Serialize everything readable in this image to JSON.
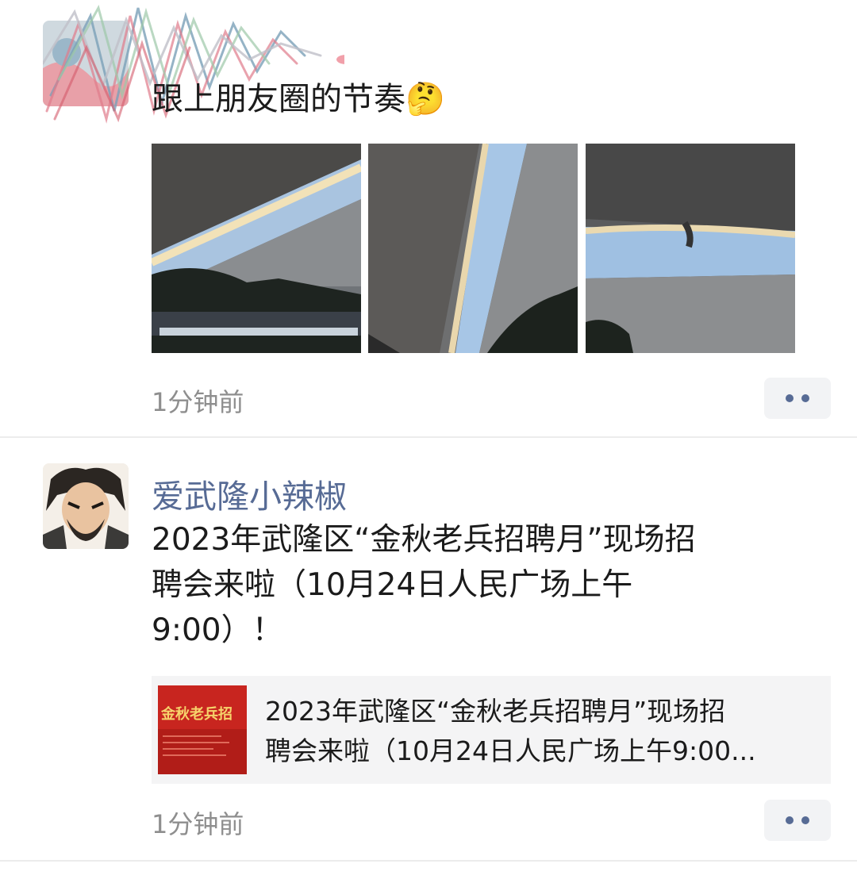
{
  "posts": [
    {
      "text": "跟上朋友圈的节奏",
      "emoji": "🤔",
      "image_count": 3,
      "time": "1分钟前"
    },
    {
      "nickname": "爱武隆小辣椒",
      "text_lines": [
        "2023年武隆区“金秋老兵招聘月”现场招",
        "聘会来啦（10月24日人民广场上午",
        "9:00）！"
      ],
      "link": {
        "thumb_text": "金秋老兵招",
        "title_lines": [
          "2023年武隆区“金秋老兵招聘月”现场招",
          "聘会来啦（10月24日人民广场上午9:00..."
        ]
      },
      "time": "1分钟前"
    }
  ],
  "colors": {
    "nickname": "#576b95",
    "time": "#8e8e8e",
    "more_dots": "#576b95",
    "card_bg": "#f4f4f5"
  },
  "icons": [
    "more-dots-icon",
    "thinking-face-emoji"
  ]
}
